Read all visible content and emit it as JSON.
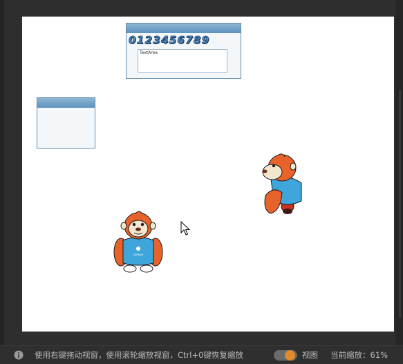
{
  "canvas": {
    "window_top": {
      "digits": "0123456789",
      "textarea_label": "TextArea"
    },
    "window_left": {}
  },
  "mascots": [
    {
      "name": "mascot-front",
      "shirt_text": "Lenovo"
    },
    {
      "name": "mascot-side"
    }
  ],
  "statusbar": {
    "info_icon": "info-icon",
    "hint": "使用右键拖动视窗，使用滚轮缩放视窗，Ctrl+0键恢复缩放",
    "view_toggle_on": true,
    "view_label": "视图",
    "zoom_label": "当前缩放：61%"
  },
  "colors": {
    "accent": "#e08a2c",
    "window_border": "#5b88ad",
    "statusbar_bg": "#2f2f2f"
  }
}
